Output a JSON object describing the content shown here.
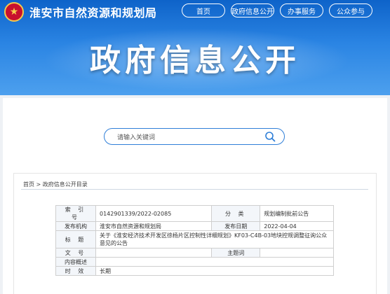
{
  "header": {
    "site_title": "淮安市自然资源和规划局",
    "emblem_icon": "national-emblem-icon",
    "nav": [
      "首页",
      "政府信息公开",
      "办事服务",
      "公众参与"
    ],
    "hero_title": "政府信息公开"
  },
  "search": {
    "placeholder": "请输入关键词",
    "icon": "search-icon"
  },
  "breadcrumb": "首页 > 政府信息公开目录",
  "info": {
    "index_label": "索 引 号",
    "index_value": "0142901339/2022-02085",
    "category_label": "分 类",
    "category_value": "规划编制批前公告",
    "org_label": "发布机构",
    "org_value": "淮安市自然资源和规划局",
    "date_label": "发布日期",
    "date_value": "2022-04-04",
    "title_label": "标 题",
    "title_value": "关于《淮安经济技术开发区徐杨片区控制性详细规划》KF03-C4B-03地块控规调整征询公众意见的公告",
    "docno_label": "文 号",
    "docno_value": "",
    "keywords_label": "主题词",
    "keywords_value": "",
    "summary_label": "内容概述",
    "summary_value": "",
    "validity_label": "时 效",
    "validity_value": "长期"
  },
  "colors": {
    "brand_blue": "#1a6fd6",
    "emblem_red": "#c8102e"
  }
}
